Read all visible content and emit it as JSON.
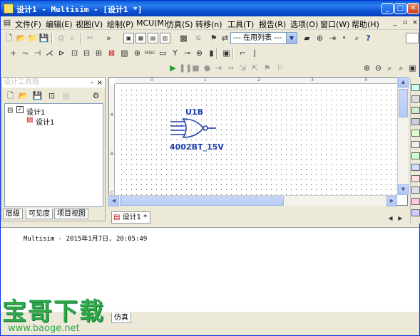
{
  "window": {
    "title": "设计1 - Multisim - [设计1 *]",
    "min_label": "_",
    "max_label": "□",
    "close_label": "✕"
  },
  "menu": {
    "items": [
      "文件(F)",
      "编辑(E)",
      "视图(V)",
      "绘制(P)",
      "MCU(M)",
      "仿真(S)",
      "转移(n)",
      "工具(T)",
      "报告(R)",
      "选项(O)",
      "窗口(W)",
      "帮助(H)"
    ]
  },
  "toolbar": {
    "in_use_list": "--- 在用列表 ---"
  },
  "design_toolbox": {
    "title": "设计工具箱",
    "close_label": "×",
    "pin_label": "-",
    "tree": {
      "root_label": "设计1",
      "child_label": "设计1",
      "expander": "⊟"
    },
    "tabs": [
      "层级",
      "可见度",
      "项目视图"
    ]
  },
  "canvas": {
    "component": {
      "ref": "U1B",
      "value": "4002BT_15V"
    },
    "ruler_top": [
      "0",
      "1",
      "2",
      "3",
      "4"
    ],
    "ruler_left": [
      "A",
      "B",
      "C"
    ]
  },
  "sheet_tab": {
    "label": "设计1 *"
  },
  "output": {
    "log_line": "Multisim  -  2015年1月7日, 20:05:49",
    "tabs": [
      "仿真"
    ]
  },
  "watermark": {
    "logo": "宝哥下载",
    "url": "www.baoge.net"
  },
  "colors": {
    "titlebar": "#0a5fd8",
    "component": "#1f3fb0",
    "watermark": "#2ea84a"
  }
}
